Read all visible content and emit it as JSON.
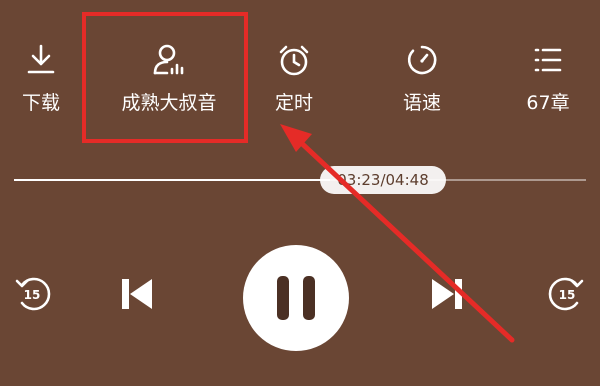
{
  "toolbar": {
    "items": [
      {
        "id": "download",
        "label": "下载",
        "icon": "download-icon"
      },
      {
        "id": "voice",
        "label": "成熟大叔音",
        "icon": "voice-person-icon"
      },
      {
        "id": "timer",
        "label": "定时",
        "icon": "alarm-clock-icon"
      },
      {
        "id": "speed",
        "label": "语速",
        "icon": "speed-dial-icon"
      },
      {
        "id": "chapters",
        "label": "67章",
        "icon": "chapter-list-icon"
      }
    ]
  },
  "player": {
    "time": "03:23/04:48",
    "progress": 0.7,
    "rewind_seconds": "15",
    "forward_seconds": "15",
    "state": "playing"
  },
  "colors": {
    "background": "#6a4634",
    "annotation": "#e52b27",
    "foreground": "#ffffff"
  }
}
